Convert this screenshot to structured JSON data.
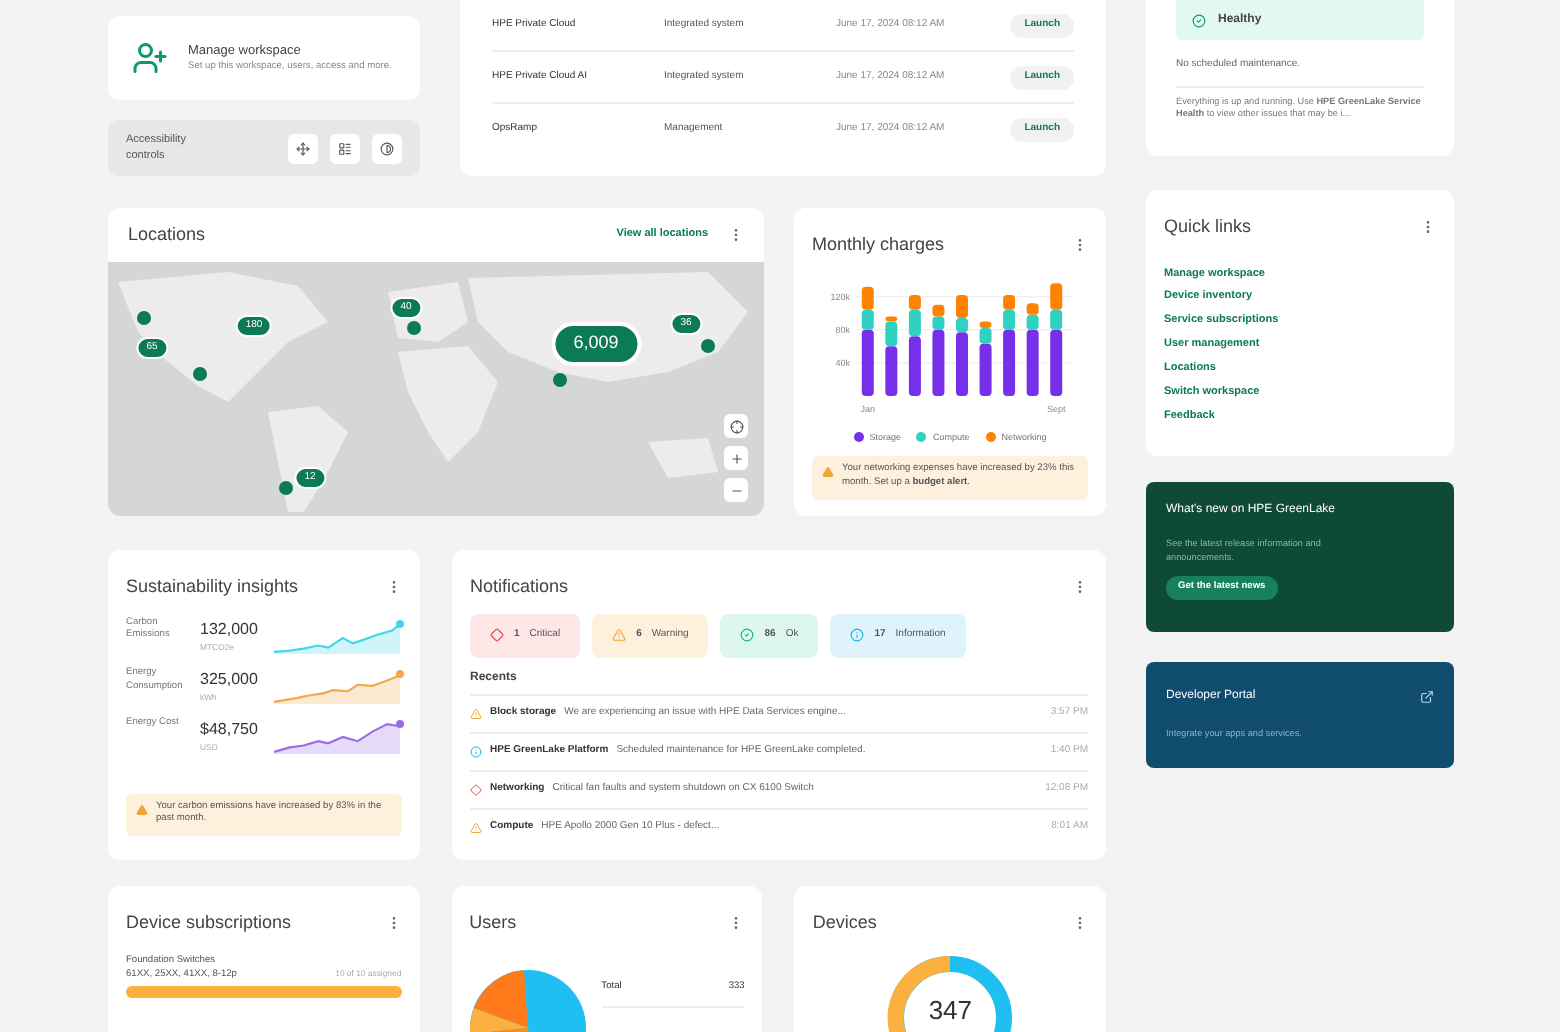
{
  "workspace_card": {
    "title": "Manage workspace",
    "description": "Set up this workspace, users, access and more."
  },
  "accessibility": {
    "label": "Accessibility controls"
  },
  "services_table": {
    "rows": [
      {
        "name": "HPE Private Cloud",
        "type": "Integrated system",
        "date": "June 17, 2024 08:12 AM",
        "action": "Launch"
      },
      {
        "name": "HPE Private Cloud AI",
        "type": "Integrated system",
        "date": "June 17, 2024 08:12 AM",
        "action": "Launch"
      },
      {
        "name": "OpsRamp",
        "type": "Management",
        "date": "June 17, 2024 08:12 AM",
        "action": "Launch"
      }
    ]
  },
  "health": {
    "status": "Healthy",
    "maintenance": "No scheduled maintenance.",
    "message": "Everything is up and running. Use **HPE GreenLake Service Health** to view other issues that may be i..."
  },
  "locations": {
    "title": "Locations",
    "link": "View all locations",
    "markers": [
      {
        "kind": "dot"
      },
      {
        "kind": "cluster",
        "label": "180"
      },
      {
        "kind": "cluster",
        "label": "65"
      },
      {
        "kind": "dot"
      },
      {
        "kind": "cluster",
        "label": "40"
      },
      {
        "kind": "dot"
      },
      {
        "kind": "big",
        "label": "6,009"
      },
      {
        "kind": "dot"
      },
      {
        "kind": "cluster",
        "label": "36"
      },
      {
        "kind": "dot"
      },
      {
        "kind": "cluster",
        "label": "12"
      },
      {
        "kind": "dot"
      }
    ]
  },
  "monthly_charges": {
    "title": "Monthly charges",
    "chart_data": {
      "type": "bar",
      "stacked": true,
      "grid": true,
      "categories": [
        "Jan",
        null,
        null,
        null,
        null,
        null,
        null,
        null,
        "Sept"
      ],
      "ylim": [
        0,
        140000
      ],
      "yticks": [
        {
          "value": 40000,
          "label": "40k"
        },
        {
          "value": 80000,
          "label": "80k"
        },
        {
          "value": 120000,
          "label": "120k"
        }
      ],
      "series": [
        {
          "name": "Storage",
          "color": "#7630ea",
          "values": [
            80000,
            60000,
            72000,
            80000,
            77000,
            63000,
            80000,
            80000,
            80000
          ]
        },
        {
          "name": "Compute",
          "color": "#2fd1c0",
          "values": [
            24000,
            30000,
            32000,
            16000,
            17000,
            19000,
            24000,
            18000,
            24000
          ]
        },
        {
          "name": "Networking",
          "color": "#ff8300",
          "values": [
            28000,
            6000,
            18000,
            14000,
            28000,
            8000,
            18000,
            14000,
            32000
          ]
        }
      ]
    },
    "alert": "Your networking expenses have increased by 23% this month. Set up a **budget alert**."
  },
  "quick_links": {
    "title": "Quick links",
    "items": [
      "Manage workspace",
      "Device inventory",
      "Service subscriptions",
      "User management",
      "Locations",
      "Switch workspace",
      "Feedback"
    ]
  },
  "whats_new": {
    "title": "What's new on HPE GreenLake",
    "description": "See the latest release information and announcements.",
    "button": "Get the latest news"
  },
  "developer_portal": {
    "title": "Developer Portal",
    "description": "Integrate your apps and services."
  },
  "sustainability": {
    "title": "Sustainability insights",
    "metrics": [
      {
        "label": "Carbon Emissions",
        "value": "132,000",
        "unit": "MTCO2e",
        "color": "#3fd8e6"
      },
      {
        "label": "Energy Consumption",
        "value": "325,000",
        "unit": "kWh",
        "color": "#f5a84a"
      },
      {
        "label": "Energy Cost",
        "value": "$48,750",
        "unit": "USD",
        "color": "#9a6be8"
      }
    ],
    "alert": "Your carbon emissions have increased by 83% in the past month."
  },
  "notifications": {
    "title": "Notifications",
    "counts": [
      {
        "kind": "critical",
        "count": "1",
        "label": "Critical"
      },
      {
        "kind": "warning",
        "count": "6",
        "label": "Warning"
      },
      {
        "kind": "ok",
        "count": "86",
        "label": "Ok"
      },
      {
        "kind": "info",
        "count": "17",
        "label": "Information"
      }
    ],
    "recents_title": "Recents",
    "items": [
      {
        "kind": "warning",
        "source": "Block storage",
        "message": "We are experiencing an issue with HPE Data Services engine...",
        "time": "3:57 PM"
      },
      {
        "kind": "info",
        "source": "HPE GreenLake Platform",
        "message": "Scheduled maintenance for HPE GreenLake completed.",
        "time": "1:40 PM"
      },
      {
        "kind": "critical",
        "source": "Networking",
        "message": "Critical fan faults and system shutdown on CX 6100 Switch",
        "time": "12:08 PM"
      },
      {
        "kind": "warning",
        "source": "Compute",
        "message": "HPE Apollo 2000 Gen 10 Plus - defect...",
        "time": "8:01 AM"
      }
    ]
  },
  "device_subscriptions": {
    "title": "Device subscriptions",
    "items": [
      {
        "name": "Foundation Switches",
        "models": "61XX, 25XX, 41XX, 8-12p",
        "assigned": "10 of 10 assigned",
        "level": 1
      }
    ]
  },
  "users": {
    "title": "Users",
    "total_label": "Total",
    "total": "333"
  },
  "devices": {
    "title": "Devices",
    "total": "347"
  }
}
